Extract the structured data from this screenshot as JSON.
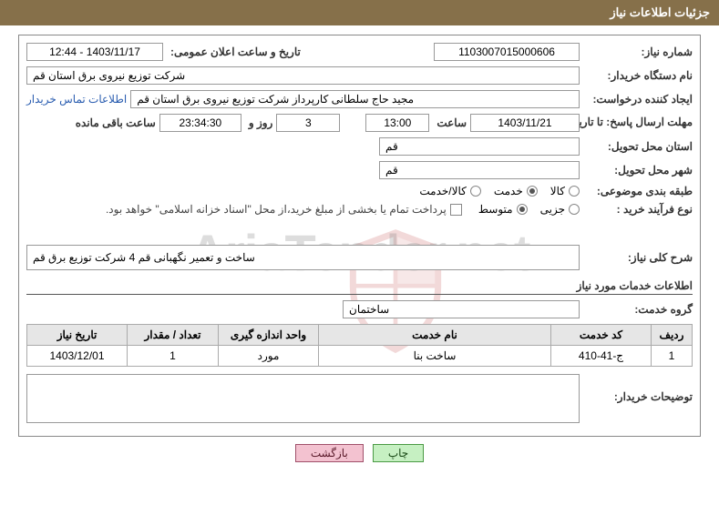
{
  "header": {
    "title": "جزئیات اطلاعات نیاز"
  },
  "fields": {
    "need_number_label": "شماره نیاز:",
    "need_number": "1103007015000606",
    "announce_label": "تاریخ و ساعت اعلان عمومی:",
    "announce_value": "1403/11/17 - 12:44",
    "buyer_org_label": "نام دستگاه خریدار:",
    "buyer_org": "شرکت توزیع نیروی برق استان قم",
    "requester_label": "ایجاد کننده درخواست:",
    "requester": "مجید حاج سلطانی کارپرداز شرکت توزیع نیروی برق استان قم",
    "contact_link": "اطلاعات تماس خریدار",
    "deadline_label": "مهلت ارسال پاسخ: تا تاریخ:",
    "deadline_date": "1403/11/21",
    "time_label": "ساعت",
    "deadline_time": "13:00",
    "days_remaining": "3",
    "days_word": "روز و",
    "time_remaining": "23:34:30",
    "remaining_suffix": "ساعت باقی مانده",
    "delivery_province_label": "استان محل تحویل:",
    "delivery_province": "قم",
    "delivery_city_label": "شهر محل تحویل:",
    "delivery_city": "قم",
    "category_label": "طبقه بندی موضوعی:",
    "category_goods": "کالا",
    "category_service": "خدمت",
    "category_goods_service": "کالا/خدمت",
    "purchase_type_label": "نوع فرآیند خرید :",
    "purchase_partial": "جزیی",
    "purchase_medium": "متوسط",
    "payment_note": "پرداخت تمام یا بخشی از مبلغ خرید،از محل \"اسناد خزانه اسلامی\" خواهد بود.",
    "need_desc_label": "شرح کلی نیاز:",
    "need_desc": "ساخت و تعمیر نگهبانی قم 4 شرکت توزیع برق قم",
    "services_info_title": "اطلاعات خدمات مورد نیاز",
    "service_group_label": "گروه خدمت:",
    "service_group": "ساختمان",
    "buyer_notes_label": "توضیحات خریدار:"
  },
  "table": {
    "headers": {
      "row": "ردیف",
      "code": "کد خدمت",
      "name": "نام خدمت",
      "unit": "واحد اندازه گیری",
      "qty": "تعداد / مقدار",
      "date": "تاریخ نیاز"
    },
    "rows": [
      {
        "row": "1",
        "code": "ج-41-410",
        "name": "ساخت بنا",
        "unit": "مورد",
        "qty": "1",
        "date": "1403/12/01"
      }
    ]
  },
  "buttons": {
    "print": "چاپ",
    "back": "بازگشت"
  },
  "watermark": "AriaTender.net"
}
